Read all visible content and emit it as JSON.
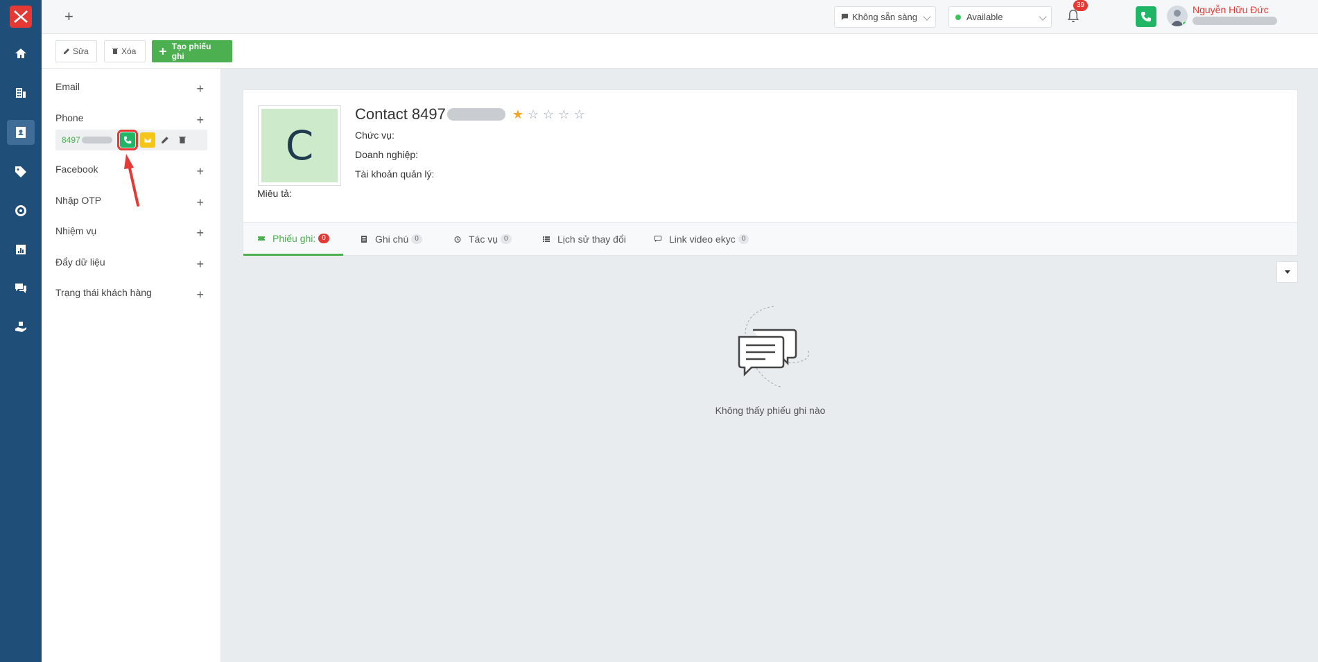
{
  "nav": {
    "items": [
      {
        "icon": "home-icon"
      },
      {
        "icon": "building-icon"
      },
      {
        "icon": "contact-card-icon",
        "active": true
      },
      {
        "icon": "tag-icon"
      },
      {
        "icon": "target-icon"
      },
      {
        "icon": "chart-icon"
      },
      {
        "icon": "chat-icon"
      },
      {
        "icon": "hand-box-icon"
      }
    ]
  },
  "header": {
    "status_select": "Không sẵn sàng",
    "availability_select": "Available",
    "notification_count": "39",
    "user_name": "Nguyễn Hữu Đức"
  },
  "toolbar": {
    "edit_label": "Sửa",
    "delete_label": "Xóa",
    "create_label": "Tạo phiếu ghi"
  },
  "left_panel": {
    "sections": [
      "Email",
      "Phone",
      "Facebook",
      "Nhập OTP",
      "Nhiệm vụ",
      "Đẩy dữ liệu",
      "Trạng thái khách hàng"
    ],
    "phone_number_visible": "8497"
  },
  "contact": {
    "avatar_letter": "C",
    "title_prefix": "Contact 8497",
    "rating": 1,
    "fields": {
      "position_label": "Chức vụ:",
      "company_label": "Doanh nghiệp:",
      "account_label": "Tài khoản quản lý:",
      "description_label": "Miêu tả:"
    }
  },
  "tabs": [
    {
      "label": "Phiếu ghi:",
      "count": "0",
      "active": true,
      "icon": "ticket-icon"
    },
    {
      "label": "Ghi chú",
      "count": "0",
      "icon": "note-icon"
    },
    {
      "label": "Tác vụ",
      "count": "0",
      "icon": "alarm-icon"
    },
    {
      "label": "Lịch sử thay đổi",
      "count": "",
      "icon": "list-icon"
    },
    {
      "label": "Link video ekyc",
      "count": "0",
      "icon": "flag-icon"
    }
  ],
  "empty_state": {
    "message": "Không thấy phiếu ghi nào"
  },
  "colors": {
    "nav_bg": "#1f4e79",
    "accent_green": "#4caf50",
    "call_green": "#21b566",
    "red": "#e53935"
  }
}
